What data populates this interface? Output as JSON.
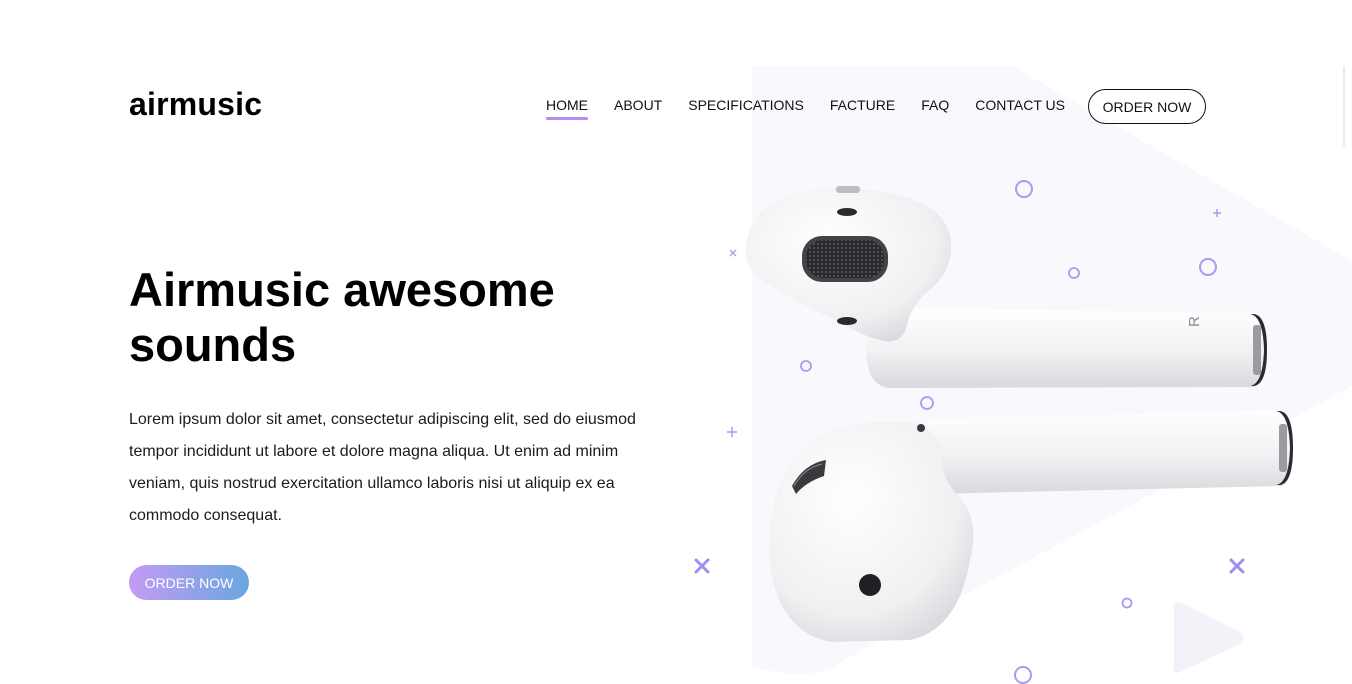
{
  "brand": {
    "logo": "airmusic"
  },
  "nav": {
    "items": [
      {
        "label": "HOME",
        "active": true
      },
      {
        "label": "ABOUT",
        "active": false
      },
      {
        "label": "SPECIFICATIONS",
        "active": false
      },
      {
        "label": "FACTURE",
        "active": false
      },
      {
        "label": "FAQ",
        "active": false
      },
      {
        "label": "CONTACT US",
        "active": false
      }
    ],
    "order_button": "ORDER NOW"
  },
  "hero": {
    "title": "Airmusic awesome sounds",
    "description": "Lorem ipsum dolor sit amet, consectetur adipiscing elit, sed do eiusmod tempor incididunt ut labore et dolore magna aliqua. Ut enim ad minim veniam, quis nostrud exercitation ullamco laboris nisi ut aliquip ex ea commodo consequat.",
    "cta_button": "ORDER NOW"
  },
  "product": {
    "earbud_marking": "R"
  },
  "colors": {
    "accent": "#b88df0",
    "cta_gradient_start": "#c49bf5",
    "cta_gradient_end": "#6aa6df",
    "decor": "#a79bf0",
    "bg_shape": "#f7f8fc"
  },
  "icons": [
    "circle-decor-icon",
    "plus-decor-icon",
    "cross-decor-icon",
    "play-triangle-icon"
  ]
}
